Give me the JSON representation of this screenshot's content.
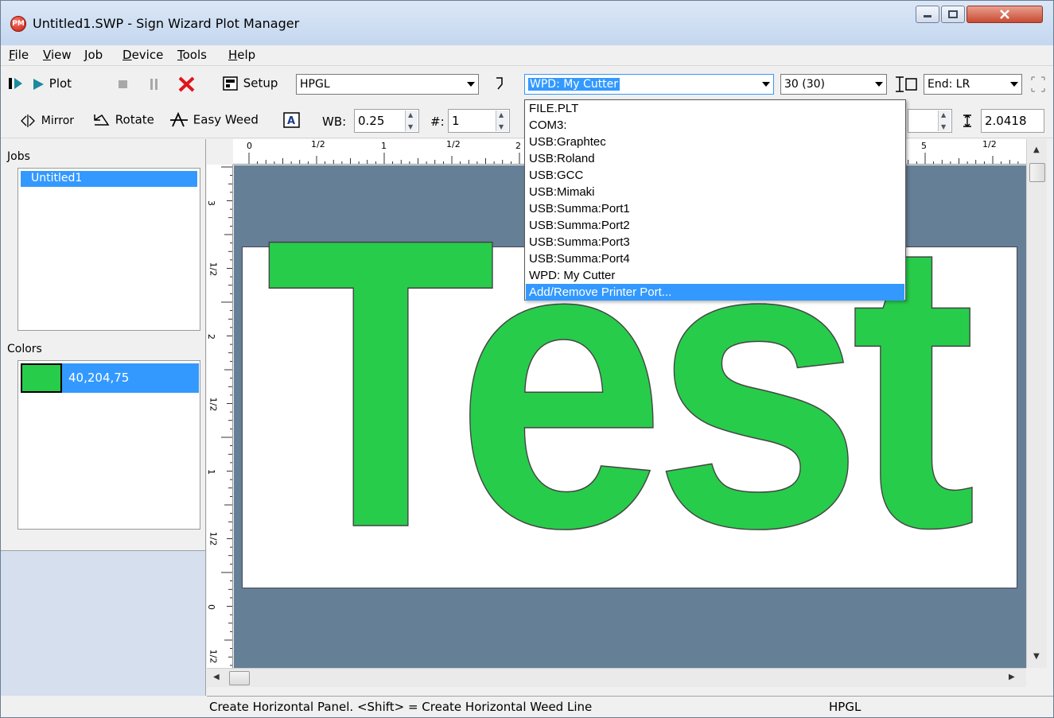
{
  "window": {
    "title": "Untitled1.SWP - Sign Wizard Plot Manager",
    "app_icon_text": "PM"
  },
  "menu": {
    "items": [
      "File",
      "View",
      "Job",
      "Device",
      "Tools",
      "Help"
    ]
  },
  "toolbar1": {
    "plot_label": "Plot",
    "setup_label": "Setup",
    "driver_value": "HPGL",
    "port_value": "WPD: My Cutter",
    "speed_value": "30 (30)",
    "end_value": "End: LR"
  },
  "toolbar2": {
    "mirror_label": "Mirror",
    "rotate_label": "Rotate",
    "easy_weed_label": "Easy Weed",
    "wb_label": "WB:",
    "wb_value": "0.25",
    "count_label": "#:",
    "count_value": "1",
    "height_value": "2.0418"
  },
  "jobs": {
    "label": "Jobs",
    "items": [
      "Untitled1"
    ]
  },
  "colors": {
    "label": "Colors",
    "items": [
      {
        "value": "40,204,75",
        "color": "#28cc4b"
      }
    ]
  },
  "ruler": {
    "h_labels": [
      "0",
      "1/2",
      "1",
      "1/2",
      "2",
      "5",
      "1/2"
    ],
    "v_labels": [
      "3",
      "1/2",
      "2",
      "1/2",
      "1",
      "1/2",
      "0",
      "1/2"
    ]
  },
  "canvas": {
    "text": "Test",
    "fill": "#28cc4b",
    "background": "#657f96"
  },
  "port_dropdown": {
    "items": [
      "FILE.PLT",
      "COM3:",
      "USB:Graphtec",
      "USB:Roland",
      "USB:GCC",
      "USB:Mimaki",
      "USB:Summa:Port1",
      "USB:Summa:Port2",
      "USB:Summa:Port3",
      "USB:Summa:Port4",
      "WPD: My Cutter",
      "Add/Remove Printer Port..."
    ],
    "selected_index": 11
  },
  "status": {
    "message": "Create Horizontal Panel. <Shift> = Create Horizontal Weed Line",
    "driver": "HPGL"
  }
}
